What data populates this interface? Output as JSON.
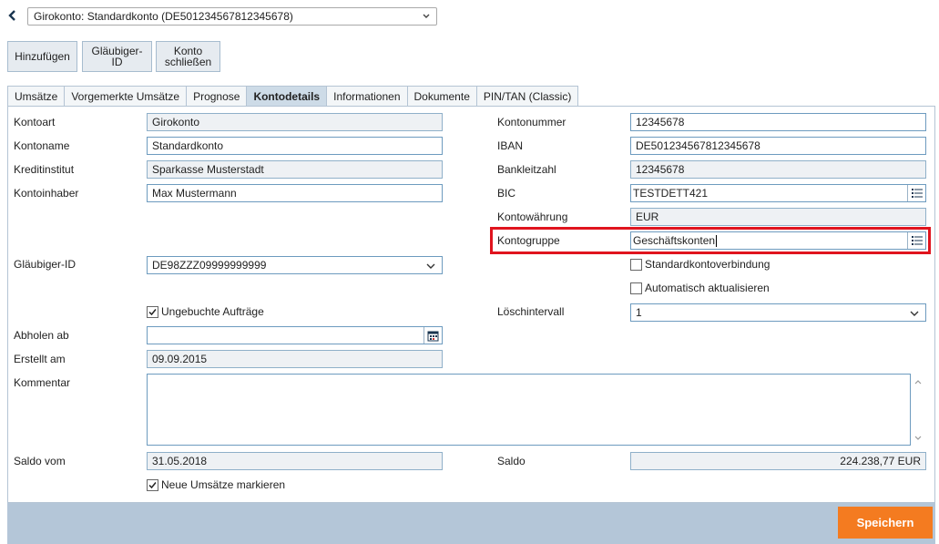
{
  "header": {
    "back_icon": "chevron-left-icon",
    "account_select_value": "Girokonto: Standardkonto (DE501234567812345678)"
  },
  "toolbar": {
    "add_label": "Hinzufügen",
    "creditor_id_line1": "Gläubiger-",
    "creditor_id_line2": "ID",
    "close_account_line1": "Konto",
    "close_account_line2": "schließen"
  },
  "tabs": [
    {
      "label": "Umsätze",
      "active": false
    },
    {
      "label": "Vorgemerkte Umsätze",
      "active": false
    },
    {
      "label": "Prognose",
      "active": false
    },
    {
      "label": "Kontodetails",
      "active": true
    },
    {
      "label": "Informationen",
      "active": false
    },
    {
      "label": "Dokumente",
      "active": false
    },
    {
      "label": "PIN/TAN (Classic)",
      "active": false
    }
  ],
  "form": {
    "kontoart": {
      "label": "Kontoart",
      "value": "Girokonto"
    },
    "kontoname": {
      "label": "Kontoname",
      "value": "Standardkonto"
    },
    "kreditinstitut": {
      "label": "Kreditinstitut",
      "value": "Sparkasse Musterstadt"
    },
    "kontoinhaber": {
      "label": "Kontoinhaber",
      "value": "Max Mustermann"
    },
    "kontonummer": {
      "label": "Kontonummer",
      "value": "12345678"
    },
    "iban": {
      "label": "IBAN",
      "value": "DE501234567812345678"
    },
    "bankleitzahl": {
      "label": "Bankleitzahl",
      "value": "12345678"
    },
    "bic": {
      "label": "BIC",
      "value": "TESTDETT421"
    },
    "kontowaehrung": {
      "label": "Kontowährung",
      "value": "EUR"
    },
    "kontogruppe": {
      "label": "Kontogruppe",
      "value": "Geschäftskonten"
    },
    "glaeubiger_id": {
      "label": "Gläubiger-ID",
      "value": "DE98ZZZ09999999999"
    },
    "standardkontoverbindung": {
      "label": "Standardkontoverbindung",
      "checked": false
    },
    "automatisch_aktualisieren": {
      "label": "Automatisch aktualisieren",
      "checked": false
    },
    "ungebuchte_auftraege": {
      "label": "Ungebuchte Aufträge",
      "checked": true
    },
    "loeschintervall": {
      "label": "Löschintervall",
      "value": "1"
    },
    "abholen_ab": {
      "label": "Abholen ab",
      "value": ""
    },
    "erstellt_am": {
      "label": "Erstellt am",
      "value": "09.09.2015"
    },
    "kommentar": {
      "label": "Kommentar",
      "value": ""
    },
    "saldo_vom": {
      "label": "Saldo vom",
      "value": "31.05.2018"
    },
    "saldo": {
      "label": "Saldo",
      "value": "224.238,77 EUR"
    },
    "neue_umsaetze_markieren": {
      "label": "Neue Umsätze markieren",
      "checked": true
    }
  },
  "footer": {
    "save_label": "Speichern"
  },
  "colors": {
    "accent_orange": "#f47b20",
    "highlight_red": "#e0141e",
    "footer_bar": "#b4c6d8"
  }
}
